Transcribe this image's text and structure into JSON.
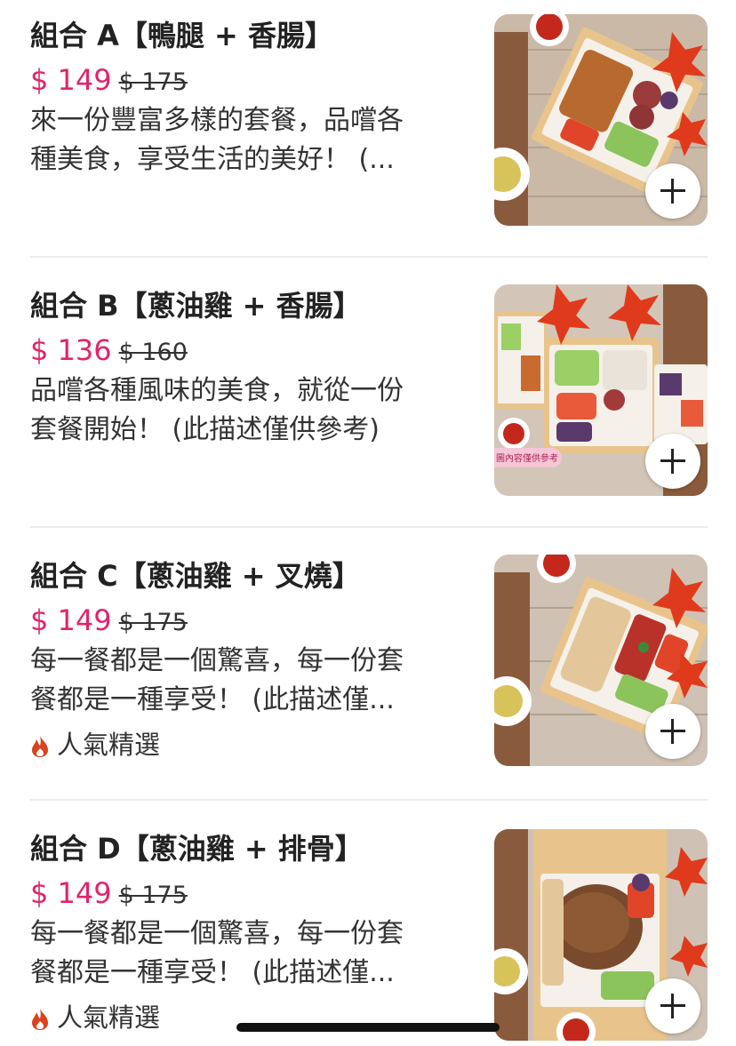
{
  "items": [
    {
      "title": "組合 A【鴨腿 + 香腸】",
      "price": "$ 149",
      "original_price": "$ 175",
      "description_line1": "來一份豐富多樣的套餐，品嚐各",
      "description_line2": "種美食，享受生活的美好！ (...",
      "badge": null
    },
    {
      "title": "組合 B【蔥油雞 + 香腸】",
      "price": "$ 136",
      "original_price": "$ 160",
      "description_line1": "品嚐各種風味的美食，就從一份",
      "description_line2": "套餐開始！ (此描述僅供參考)",
      "photo_label": "圖內容僅供參考",
      "badge": null
    },
    {
      "title": "組合 C【蔥油雞 + 叉燒】",
      "price": "$ 149",
      "original_price": "$ 175",
      "description_line1": "每一餐都是一個驚喜，每一份套",
      "description_line2": "餐都是一種享受！ (此描述僅...",
      "badge": "人氣精選"
    },
    {
      "title": "組合 D【蔥油雞 + 排骨】",
      "price": "$ 149",
      "original_price": "$ 175",
      "description_line1": "每一餐都是一個驚喜，每一份套",
      "description_line2": "餐都是一種享受！ (此描述僅...",
      "badge": "人氣精選"
    }
  ],
  "icons": {
    "add_button": "plus-icon",
    "badge_icon": "flame-icon"
  },
  "colors": {
    "price": "#e0256b",
    "flame": "#d9431e",
    "divider": "#ececec"
  }
}
